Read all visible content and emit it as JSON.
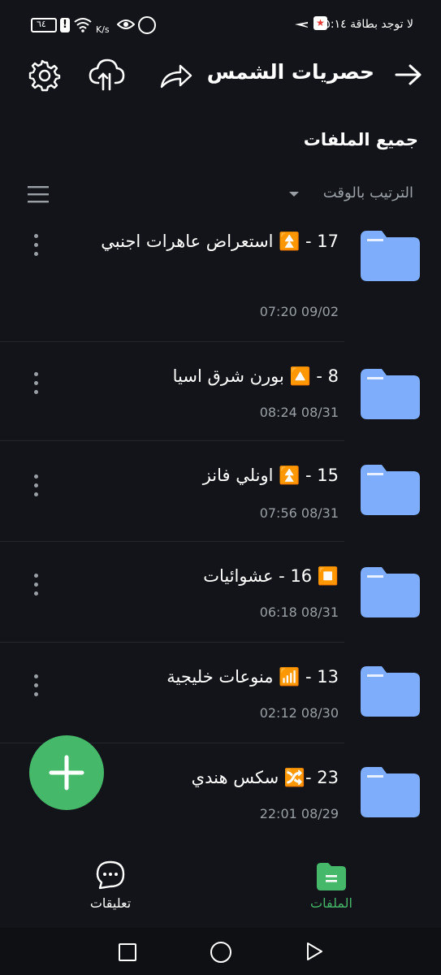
{
  "status_bar": {
    "carrier": "لا توجد بطاقة",
    "time": "٥:١٤",
    "battery": "٦٤",
    "speed": "K/s"
  },
  "header": {
    "title": "حصريات الشمس",
    "icons": [
      "back-arrow-icon",
      "share-icon",
      "cloud-upload-icon",
      "gear-icon"
    ]
  },
  "section": {
    "title": "جميع الملفات",
    "sort_label": "الترتيب بالوقت"
  },
  "items": [
    {
      "title": "17 - ⏫ استعراض عاهرات اجنبي",
      "date": "07:20 09/02"
    },
    {
      "title": "8 - 🔼 بورن شرق اسيا",
      "date": "08:24 08/31"
    },
    {
      "title": "15 - ⏫ اونلي فانز",
      "date": "07:56 08/31"
    },
    {
      "title": "⏹️ 16 - عشوائيات",
      "date": "06:18 08/31"
    },
    {
      "title": "13 - 📶 منوعات خليجية",
      "date": "02:12 08/30"
    },
    {
      "title": "23 -🔀 سكس هندي",
      "date": "22:01 08/29"
    }
  ],
  "bottom_nav": {
    "files": "الملفات",
    "comments": "تعليقات"
  },
  "colors": {
    "background": "#121419",
    "folder": "#7eaefb",
    "accent_green": "#46b86a",
    "badge_orange": "#f5a742"
  }
}
